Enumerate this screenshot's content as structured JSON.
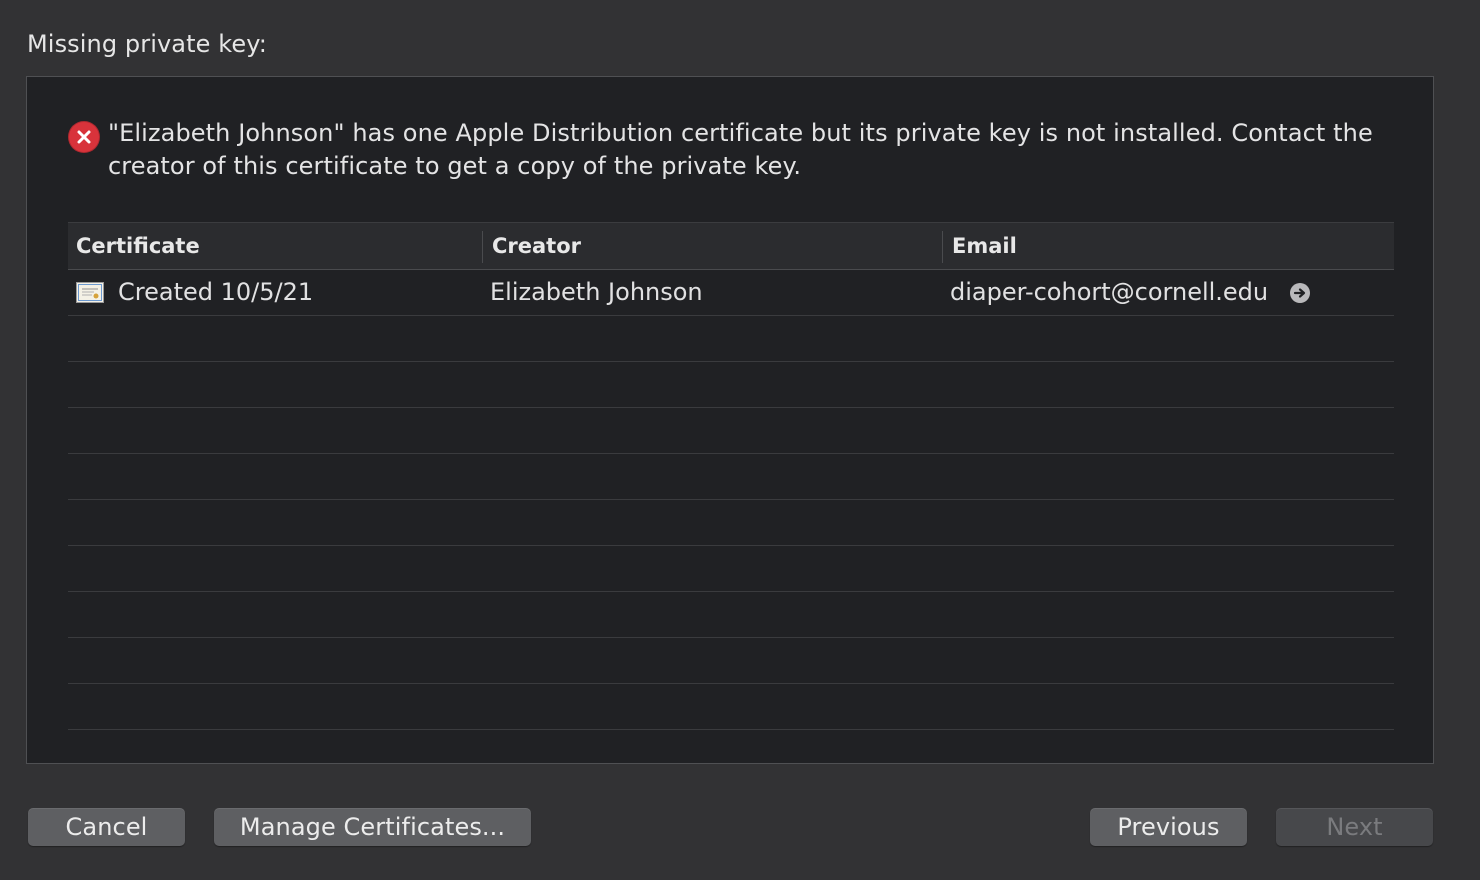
{
  "section_title": "Missing private key:",
  "error": {
    "icon": "error-x-icon",
    "message": "\"Elizabeth Johnson\" has one Apple Distribution certificate but its private key is not installed. Contact the creator of this certificate to get a copy of the private key."
  },
  "table": {
    "columns": [
      "Certificate",
      "Creator",
      "Email"
    ],
    "rows": [
      {
        "certificate": "Created 10/5/21",
        "creator": "Elizabeth Johnson",
        "email": "diaper-cohort@cornell.edu"
      }
    ]
  },
  "buttons": {
    "cancel": "Cancel",
    "manage": "Manage Certificates...",
    "previous": "Previous",
    "next": "Next"
  },
  "colors": {
    "background": "#323234",
    "panel": "#202124",
    "error_red": "#d8333b",
    "button": "#5e5f62"
  }
}
